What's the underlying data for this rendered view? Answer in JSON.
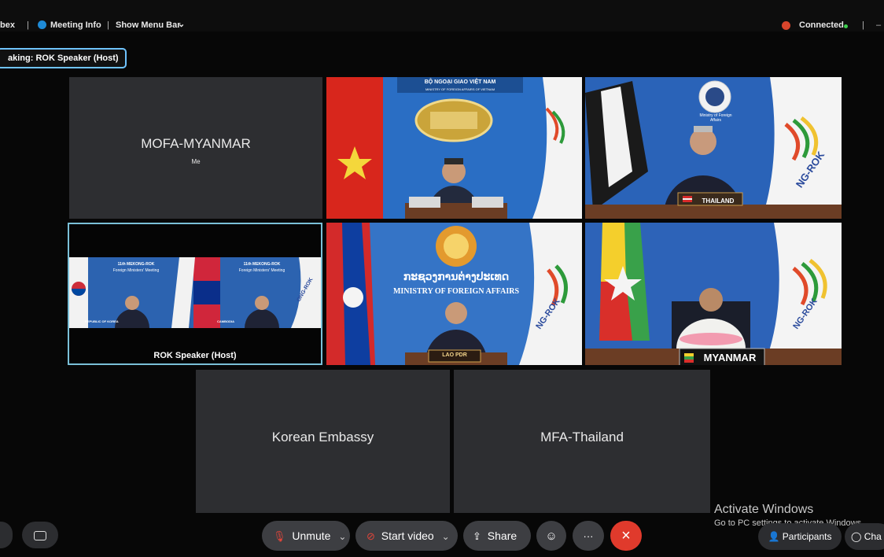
{
  "topbar": {
    "app_fragment": "bex",
    "sep1": "|",
    "meeting_info": "Meeting Info",
    "sep2": "|",
    "show_menu_bar": "Show Menu Bar",
    "status": "Connected",
    "sep3": "|",
    "sep4": "–"
  },
  "speaking_banner": "aking: ROK Speaker (Host)",
  "tiles": {
    "myanmar_blank": {
      "name": "MOFA-MYANMAR",
      "sub": "Me"
    },
    "vietnam": {
      "banner": "BỘ NGOẠI GIAO VIỆT NAM",
      "banner_sub": "MINISTRY OF FOREIGN AFFAIRS OF VIETNAM"
    },
    "thailand": {
      "plate": "THAILAND",
      "seal_text": "Ministry of Foreign Affairs",
      "flag_text": "NG-ROK"
    },
    "host": {
      "caption": "ROK Speaker  (Host)",
      "left_panel_title": "11th MEKONG-ROK",
      "left_panel_sub": "Foreign Ministers' Meeting",
      "left_plate": "REPUBLIC OF KOREA",
      "right_panel_title": "11th MEKONG-ROK",
      "right_panel_sub": "Foreign Ministers' Meeting",
      "right_plate": "CAMBODIA",
      "flag_text": "ONG-ROK"
    },
    "laos": {
      "lao_text": "ກະຊວງການຕ່າງປະເທດ",
      "ministry": "MINISTRY OF FOREIGN AFFAIRS",
      "plate": "LAO PDR",
      "flag_text": "NG-ROK"
    },
    "myanmar_video": {
      "plate": "MYANMAR",
      "flag_text": "NG-ROK"
    },
    "korean_embassy": {
      "name": "Korean Embassy"
    },
    "mfa_thailand": {
      "name": "MFA-Thailand"
    }
  },
  "controls": {
    "unmute": "Unmute",
    "start_video": "Start video",
    "share": "Share",
    "more": "···",
    "end": "×",
    "chev": "⌄",
    "participants": "Participants",
    "chat": "Cha",
    "left_btn": "▫"
  },
  "watermark": {
    "line1": "Activate Windows",
    "line2": "Go to PC settings to activate Windows"
  },
  "colors": {
    "end_call": "#e03a2c",
    "record": "#d8452c",
    "connected": "#3ccf4e",
    "highlight": "#6fc3ff"
  }
}
